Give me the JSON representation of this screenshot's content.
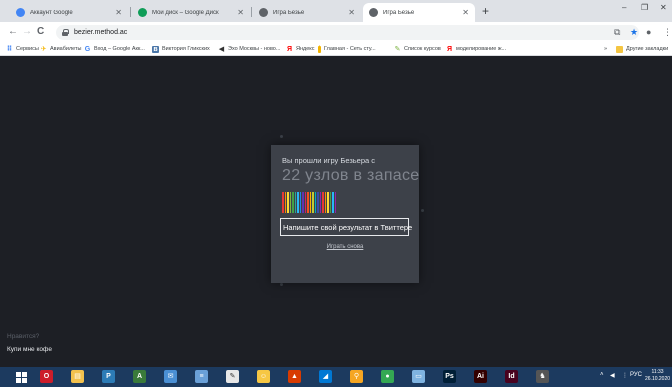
{
  "tabs": [
    {
      "title": "Аккаунт Google",
      "favicon_color": "#4285f4",
      "active": false
    },
    {
      "title": "Мой диск – Google Диск",
      "favicon_color": "#0f9d58",
      "active": false
    },
    {
      "title": "Игра Безье",
      "favicon_color": "#5f6368",
      "active": false
    },
    {
      "title": "Игра Безье",
      "favicon_color": "#5f6368",
      "active": true
    }
  ],
  "new_tab_label": "+",
  "window_controls": {
    "minimize": "–",
    "maximize": "❐",
    "close": "✕"
  },
  "nav": {
    "back": "←",
    "forward": "→",
    "reload": "C"
  },
  "address": {
    "url": "bezier.method.ac"
  },
  "bookmarks": [
    {
      "label": "Сервисы",
      "icon": "apps-icon",
      "color": "#4285f4",
      "glyph": "⠿"
    },
    {
      "label": "Авиабилеты",
      "icon": "plane-icon",
      "color": "#f4b400",
      "glyph": "✈"
    },
    {
      "label": "Вход – Google Акк...",
      "icon": "google-icon",
      "color": "#4285f4",
      "glyph": "G"
    },
    {
      "label": "Виктория Гликских",
      "icon": "vk-icon",
      "color": "#4a76a8",
      "glyph": "в"
    },
    {
      "label": "Эхо Москвы - ново...",
      "icon": "echo-icon",
      "color": "#333333",
      "glyph": "◀"
    },
    {
      "label": "Яндекс",
      "icon": "yandex-icon",
      "color": "#ff0000",
      "glyph": "Я"
    },
    {
      "label": "Главная - Сеть сту...",
      "icon": "network-icon",
      "color": "#f4b400",
      "glyph": "|"
    },
    {
      "label": "Список курсов",
      "icon": "courses-icon",
      "color": "#7cb342",
      "glyph": "✎"
    },
    {
      "label": "моделирование ж...",
      "icon": "yandex-icon",
      "color": "#ff0000",
      "glyph": "Я"
    }
  ],
  "bookmarks_more": "»",
  "other_bookmarks": "Другие закладки",
  "modal": {
    "subtitle": "Вы прошли игру Безьера с",
    "headline": "22 узлов в запасе",
    "bar_count": 22,
    "bar_colors": [
      "#e53935",
      "#fb8c00",
      "#fdd835",
      "#7cb342",
      "#43a047",
      "#26a69a",
      "#29b6f6",
      "#1e88e5",
      "#5e35b1",
      "#d81b60",
      "#f4511e",
      "#ffb300",
      "#c0ca33",
      "#00acc1",
      "#3949ab",
      "#8e24aa",
      "#e53935",
      "#fb8c00",
      "#fdd835",
      "#43a047",
      "#29b6f6",
      "#8e24aa"
    ],
    "tweet_label": "Напишите свой результат в Твиттере",
    "play_again_label": "Играть снова"
  },
  "sponsor": {
    "question": "Нравится?",
    "link": "Купи мне кофе"
  },
  "taskbar": {
    "apps": [
      {
        "name": "opera",
        "color": "#cc1d2a",
        "glyph": "O"
      },
      {
        "name": "explorer",
        "color": "#f2c14e",
        "glyph": "▤"
      },
      {
        "name": "publisher",
        "color": "#2c7bb6",
        "glyph": "P"
      },
      {
        "name": "access",
        "color": "#3a7a3a",
        "glyph": "A"
      },
      {
        "name": "mail",
        "color": "#4a8fd4",
        "glyph": "✉"
      },
      {
        "name": "word-doc",
        "color": "#6aa0d8",
        "glyph": "≡"
      },
      {
        "name": "paint",
        "color": "#e7e7e7",
        "glyph": "✎"
      },
      {
        "name": "smile",
        "color": "#f6c744",
        "glyph": "☺"
      },
      {
        "name": "acrobat",
        "color": "#d83b01",
        "glyph": "▲"
      },
      {
        "name": "azure",
        "color": "#0078d4",
        "glyph": "◢"
      },
      {
        "name": "search",
        "color": "#f5a623",
        "glyph": "⚲"
      },
      {
        "name": "chrome",
        "color": "#34a853",
        "glyph": "●"
      },
      {
        "name": "screen",
        "color": "#7fb3e0",
        "glyph": "▭"
      },
      {
        "name": "photoshop",
        "color": "#001e36",
        "glyph": "Ps"
      },
      {
        "name": "illustrator",
        "color": "#330000",
        "glyph": "Ai"
      },
      {
        "name": "indesign",
        "color": "#49021f",
        "glyph": "Id"
      },
      {
        "name": "game",
        "color": "#555555",
        "glyph": "♞"
      }
    ],
    "tray_language": "РУС",
    "clock_time": "11:33",
    "clock_date": "26.10.2020"
  }
}
